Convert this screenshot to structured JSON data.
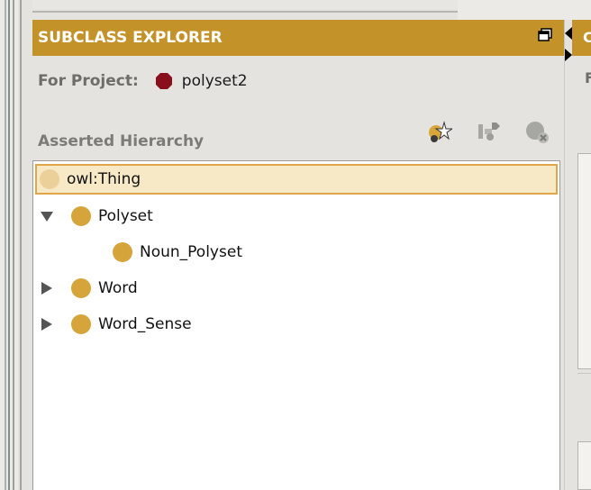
{
  "panel": {
    "title": "SUBCLASS EXPLORER",
    "project_label": "For Project:",
    "project_name": "polyset2",
    "hierarchy_label": "Asserted Hierarchy"
  },
  "tree": {
    "root": "owl:Thing",
    "items": [
      {
        "label": "Polyset",
        "state": "expanded"
      },
      {
        "label": "Noun_Polyset",
        "state": "leaf"
      },
      {
        "label": "Word",
        "state": "collapsed"
      },
      {
        "label": "Word_Sense",
        "state": "collapsed"
      }
    ]
  },
  "right_panel": {
    "header_char": "C",
    "label_char": "F"
  },
  "colors": {
    "header_bg": "#c3932a",
    "class_node": "#d5a43a",
    "root_node": "#ebd09a",
    "selection_bg": "#f8e9c6",
    "selection_border": "#e0a548",
    "project_icon": "#8a0f1c"
  },
  "icons": {
    "maximize": "maximize-icon",
    "add_subclass": "add-subclass-icon",
    "add_sibling": "add-sibling-icon",
    "delete_class": "delete-class-icon"
  }
}
